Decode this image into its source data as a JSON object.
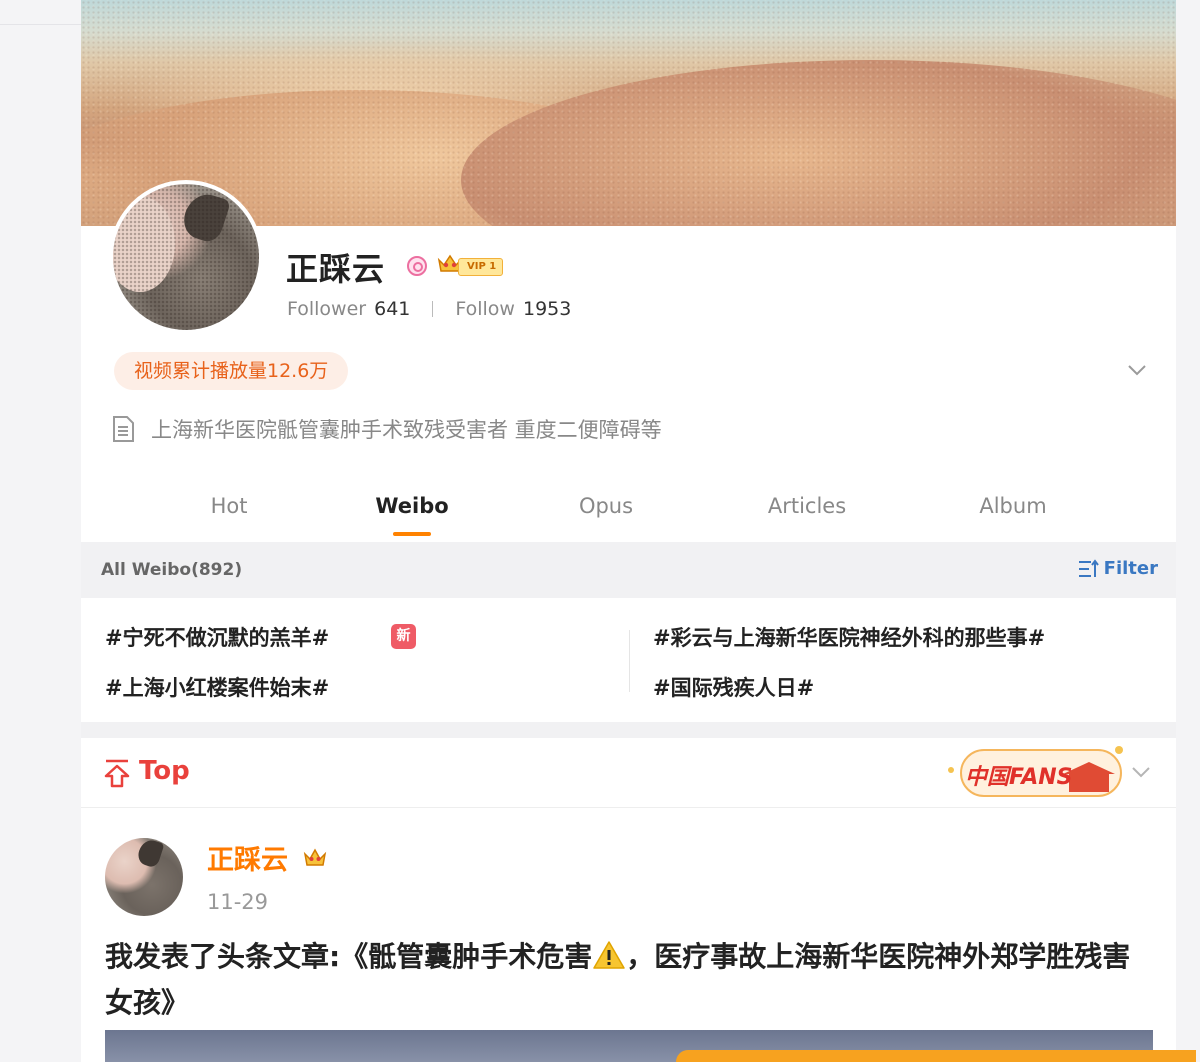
{
  "profile": {
    "name": "正踩云",
    "vip_label": "VIP 1",
    "follower_label": "Follower",
    "follower_count": "641",
    "follow_label": "Follow",
    "follow_count": "1953",
    "video_stat": "视频累计播放量12.6万",
    "bio": "上海新华医院骶管囊肿手术致残受害者 重度二便障碍等"
  },
  "tabs": [
    {
      "label": "Hot"
    },
    {
      "label": "Weibo"
    },
    {
      "label": "Opus"
    },
    {
      "label": "Articles"
    },
    {
      "label": "Album"
    }
  ],
  "active_tab": "Weibo",
  "feed": {
    "all_label": "All Weibo(892)",
    "filter_label": "Filter"
  },
  "topics": {
    "items": [
      "#宁死不做沉默的羔羊#",
      "#上海小红楼案件始末#",
      "#彩云与上海新华医院神经外科的那些事#",
      "#国际残疾人日#"
    ],
    "new_badge": "新"
  },
  "pinned": {
    "label": "Top",
    "fans_badge_text": "中国FANS",
    "author": "正踩云",
    "date": "11-29",
    "text_before_icon": "我发表了头条文章:《骶管囊肿手术危害",
    "text_after_icon": "，医疗事故上海新华医院神外郑学胜残害女孩》"
  },
  "colors": {
    "accent": "#ff8200",
    "link": "#3a78c2",
    "top_red": "#e9413c",
    "pill_text": "#e8621b"
  },
  "icons": [
    "verified-icon",
    "crown-icon",
    "chevron-down-icon",
    "document-icon",
    "filter-icon",
    "pin-top-icon",
    "warning-icon"
  ]
}
